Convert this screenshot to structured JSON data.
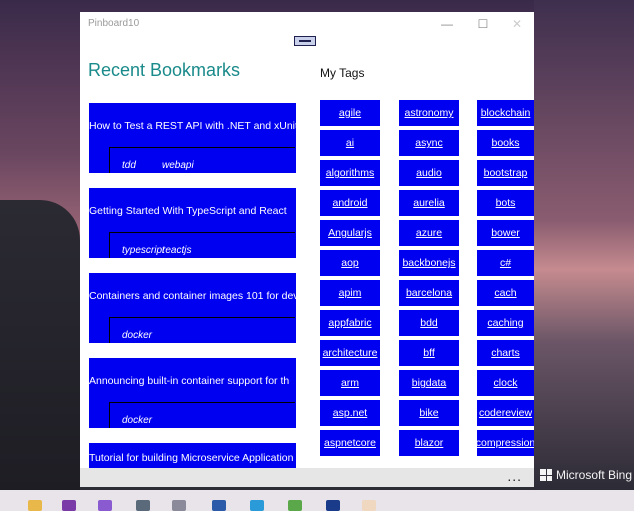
{
  "window": {
    "title": "Pinboard10",
    "minimize": "—",
    "maximize": "☐",
    "close": "✕"
  },
  "page": {
    "recent_title": "Recent Bookmarks",
    "tags_title": "My Tags",
    "more": "..."
  },
  "bookmarks": [
    {
      "title": "How to Test a REST API with .NET and xUnit -",
      "tags": [
        "tdd",
        "webapi"
      ]
    },
    {
      "title": "Getting Started With TypeScript and React",
      "tags": [
        "typescript",
        "reactjs"
      ]
    },
    {
      "title": "Containers and container images 101 for dev",
      "tags": [
        "docker"
      ]
    },
    {
      "title": "Announcing built-in container support for th",
      "tags": [
        "docker"
      ]
    },
    {
      "title": "Tutorial for building Microservice Application",
      "tags": []
    }
  ],
  "tags": [
    "agile",
    "astronomy",
    "blockchain",
    "ai",
    "async",
    "books",
    "algorithms",
    "audio",
    "bootstrap",
    "android",
    "aurelia",
    "bots",
    "Angularjs",
    "azure",
    "bower",
    "aop",
    "backbonejs",
    "c#",
    "apim",
    "barcelona",
    "cach",
    "appfabric",
    "bdd",
    "caching",
    "architecture",
    "bff",
    "charts",
    "arm",
    "bigdata",
    "clock",
    "asp.net",
    "bike",
    "codereview",
    "aspnetcore",
    "blazor",
    "compression"
  ],
  "desktop": {
    "watermark": "Microsoft Bing"
  },
  "colors": {
    "tile": "#0000f0",
    "accent_title": "#1a8a8a"
  }
}
